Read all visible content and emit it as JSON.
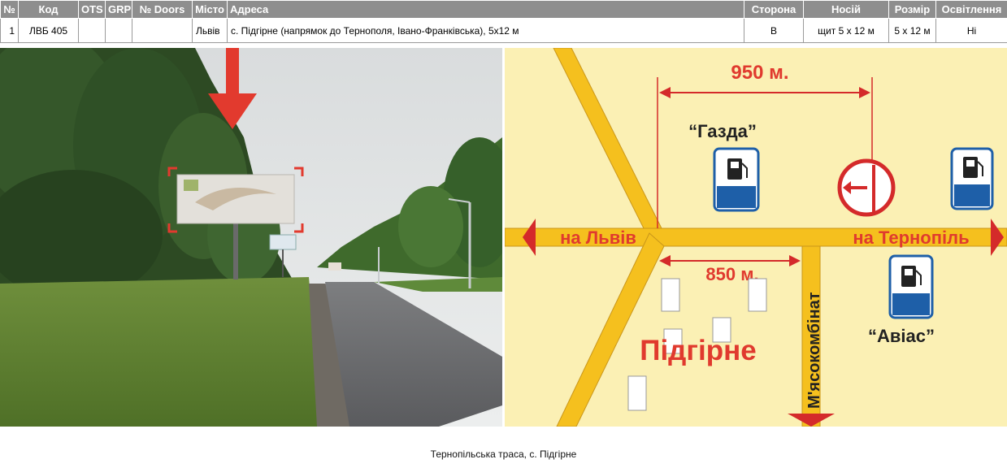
{
  "table": {
    "headers": [
      "№",
      "Код",
      "OTS",
      "GRP",
      "№ Doors",
      "Місто",
      "Адреса",
      "Сторона",
      "Носій",
      "Розмір",
      "Освітлення"
    ],
    "row": {
      "num": "1",
      "code": "ЛВБ 405",
      "ots": "",
      "grp": "",
      "doors": "",
      "city": "Львів",
      "address": "с. Підгірне (напрямок до Тернополя, Івано-Франківська), 5x12 м",
      "side": "B",
      "carrier": "щит 5 x 12 м",
      "size": "5 x 12 м",
      "lighting": "Ні"
    }
  },
  "map": {
    "distance_top": "950 м.",
    "distance_bottom": "850 м.",
    "label_gazda": "“Газда”",
    "label_avias": "“Авіас”",
    "to_lviv": "на Львів",
    "to_ternopil": "на Тернопіль",
    "village": "Підгірне",
    "street": "М'ясокомбінат",
    "colors": {
      "background": "#fbf0b4",
      "road": "#f5c01e",
      "text_red": "#e03a2e",
      "arrow_red": "#d42a2a",
      "sign_blue": "#1e5fa8"
    }
  },
  "icons": {
    "fuel_sign": "fuel-station-sign-icon",
    "no_left_turn": "no-left-turn-sign-icon",
    "direction_arrow": "red-arrow-icon"
  },
  "caption": "Тернопільська траса, с. Підгірне"
}
